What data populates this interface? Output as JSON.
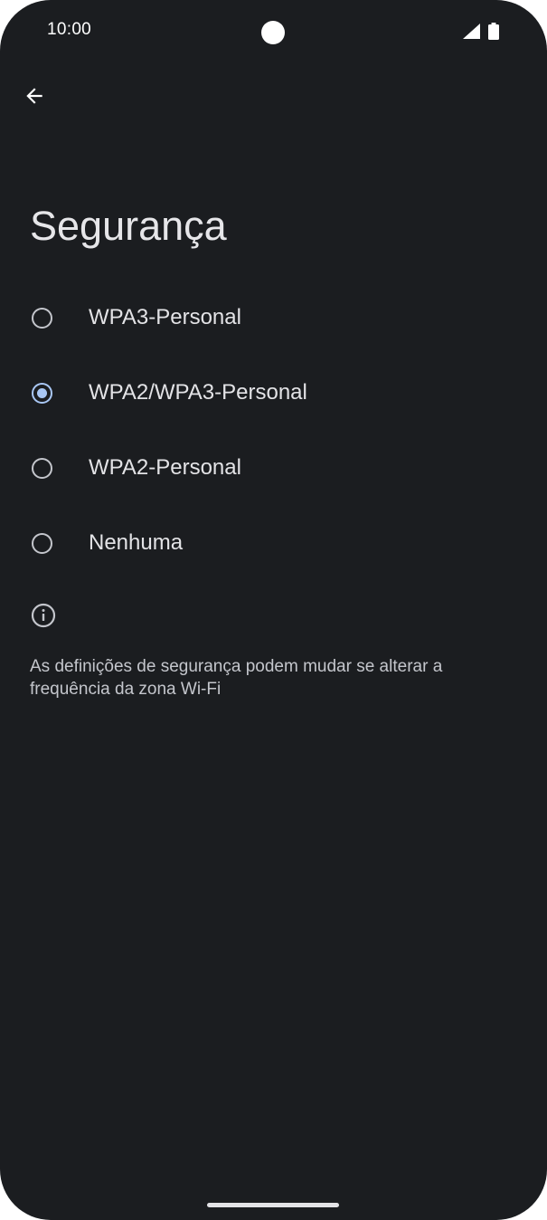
{
  "status_bar": {
    "time": "10:00",
    "icons": [
      "signal-icon",
      "battery-icon"
    ]
  },
  "toolbar": {
    "back_icon": "arrow-back-icon"
  },
  "page": {
    "title": "Segurança"
  },
  "security_options": [
    {
      "label": "WPA3-Personal",
      "selected": false
    },
    {
      "label": "WPA2/WPA3-Personal",
      "selected": true
    },
    {
      "label": "WPA2-Personal",
      "selected": false
    },
    {
      "label": "Nenhuma",
      "selected": false
    }
  ],
  "info": {
    "icon": "info-icon",
    "text": "As definições de segurança podem mudar se alterar a frequência da zona Wi-Fi"
  },
  "colors": {
    "background": "#1b1d20",
    "accent": "#a9c7f4",
    "text_primary": "#e3e3e6",
    "text_secondary": "#c4c6cc"
  }
}
